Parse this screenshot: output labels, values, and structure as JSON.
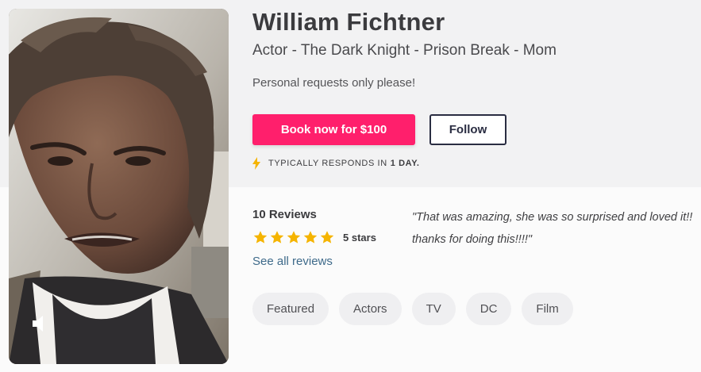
{
  "profile": {
    "name": "William Fichtner",
    "tagline": "Actor - The Dark Knight - Prison Break - Mom",
    "bio": "Personal requests only please!"
  },
  "actions": {
    "book_label": "Book now for $100",
    "follow_label": "Follow"
  },
  "response": {
    "prefix": "TYPICALLY RESPONDS IN",
    "time": "1 DAY."
  },
  "reviews": {
    "count_label": "10 Reviews",
    "rating": 5,
    "stars_label": "5 stars",
    "see_all_label": "See all reviews",
    "featured_quote": "\"That was amazing, she was so surprised and loved it!! thanks for doing this!!!!\""
  },
  "tags": [
    "Featured",
    "Actors",
    "TV",
    "DC",
    "Film"
  ],
  "video": {
    "mute_icon": "speaker-icon"
  },
  "colors": {
    "accent": "#ff1f6c",
    "star": "#f5b400",
    "follow_border": "#2a2d42",
    "link": "#3e6a8a"
  }
}
